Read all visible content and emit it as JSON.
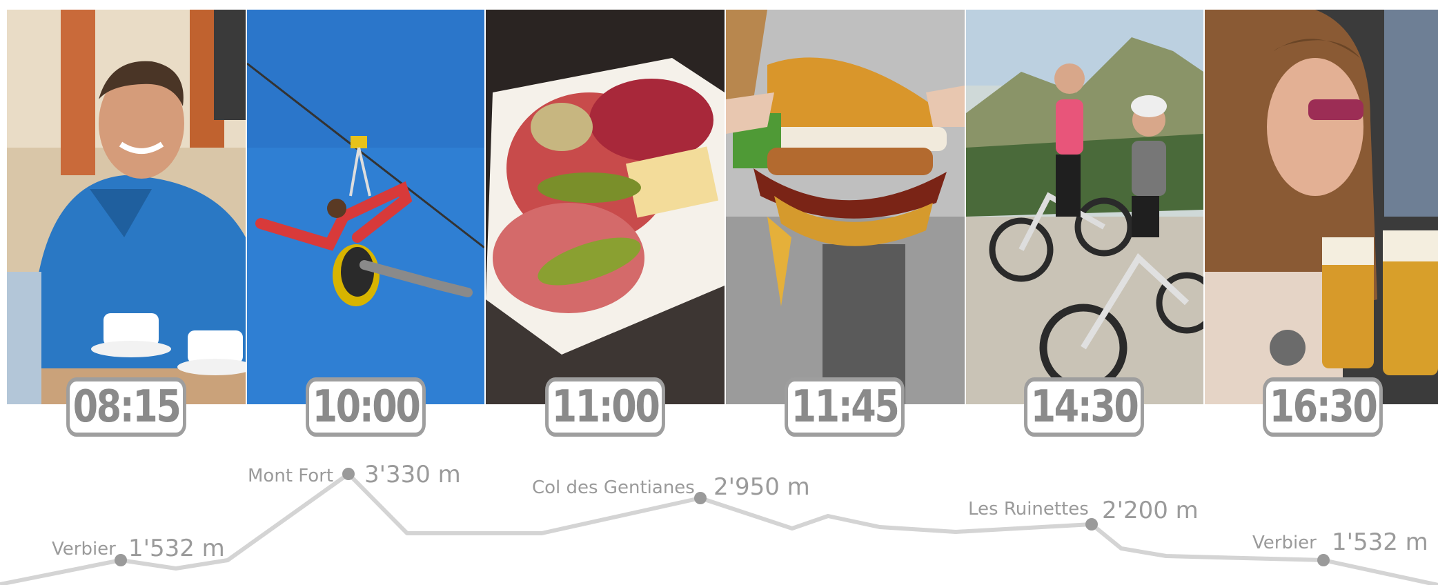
{
  "timeline": [
    {
      "time": "08:15",
      "image": "man-blue-jacket-coffee"
    },
    {
      "time": "10:00",
      "image": "zipline-blue-sky"
    },
    {
      "time": "11:00",
      "image": "charcuterie-plate"
    },
    {
      "time": "11:45",
      "image": "bacon-burger"
    },
    {
      "time": "14:30",
      "image": "mountain-e-bikes"
    },
    {
      "time": "16:30",
      "image": "woman-beer-mugs"
    }
  ],
  "waypoints": [
    {
      "name": "Verbier",
      "altitude": "1'532 m"
    },
    {
      "name": "Mont Fort",
      "altitude": "3'330 m"
    },
    {
      "name": "Col des Gentianes",
      "altitude": "2'950 m"
    },
    {
      "name": "Les Ruinettes",
      "altitude": "2'200 m"
    },
    {
      "name": "Verbier",
      "altitude": "1'532 m"
    }
  ],
  "colors": {
    "frame_border": "#9e9e9e",
    "time_text": "#8a8a8a",
    "profile_line": "#d4d4d4",
    "point": "#9a9a9a",
    "label": "#9a9a9a"
  }
}
